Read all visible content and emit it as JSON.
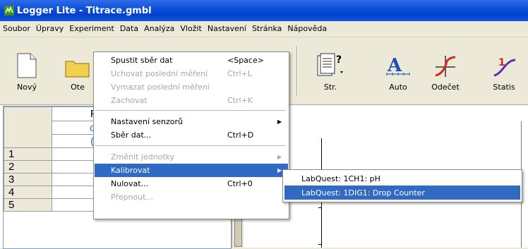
{
  "window": {
    "title": "Logger Lite - Titrace.gmbl"
  },
  "menubar": [
    "Soubor",
    "Úpravy",
    "Experiment",
    "Data",
    "Analýza",
    "Vložit",
    "Nastavení",
    "Stránka",
    "Nápověda"
  ],
  "toolbar": {
    "novy": "Nový",
    "otevrit": "Ote",
    "str": "Str.",
    "auto": "Auto",
    "odecet": "Odečet",
    "statistika": "Statis"
  },
  "table": {
    "header1": "Po",
    "header2": "obj",
    "header3": "(m",
    "rows": [
      "1",
      "2",
      "3",
      "4",
      "5"
    ]
  },
  "experiment_menu": {
    "items": [
      {
        "label": "Spustit sběr dat",
        "shortcut": "<Space>"
      },
      {
        "label": "Uchovat poslední měření",
        "shortcut": "Ctrl+L"
      },
      {
        "label": "Vymazat poslední měření",
        "shortcut": ""
      },
      {
        "label": "Zachovat",
        "shortcut": "Ctrl+K"
      },
      {
        "label": "Nastavení senzorů",
        "shortcut": ""
      },
      {
        "label": "Sběr dat...",
        "shortcut": "Ctrl+D"
      },
      {
        "label": "Změnit jednotky",
        "shortcut": ""
      },
      {
        "label": "Kalibrovat",
        "shortcut": ""
      },
      {
        "label": "Nulovat...",
        "shortcut": "Ctrl+0"
      },
      {
        "label": "Přepnout...",
        "shortcut": ""
      }
    ]
  },
  "calibrate_submenu": {
    "items": [
      "LabQuest: 1CH1: pH",
      "LabQuest: 1DIG1: Drop Counter"
    ]
  },
  "colors": {
    "titlebar": "#0a4fd8",
    "highlight": "#316ac5",
    "disabled_text": "#a7a6aa",
    "column_units": "#2a6fd6"
  }
}
